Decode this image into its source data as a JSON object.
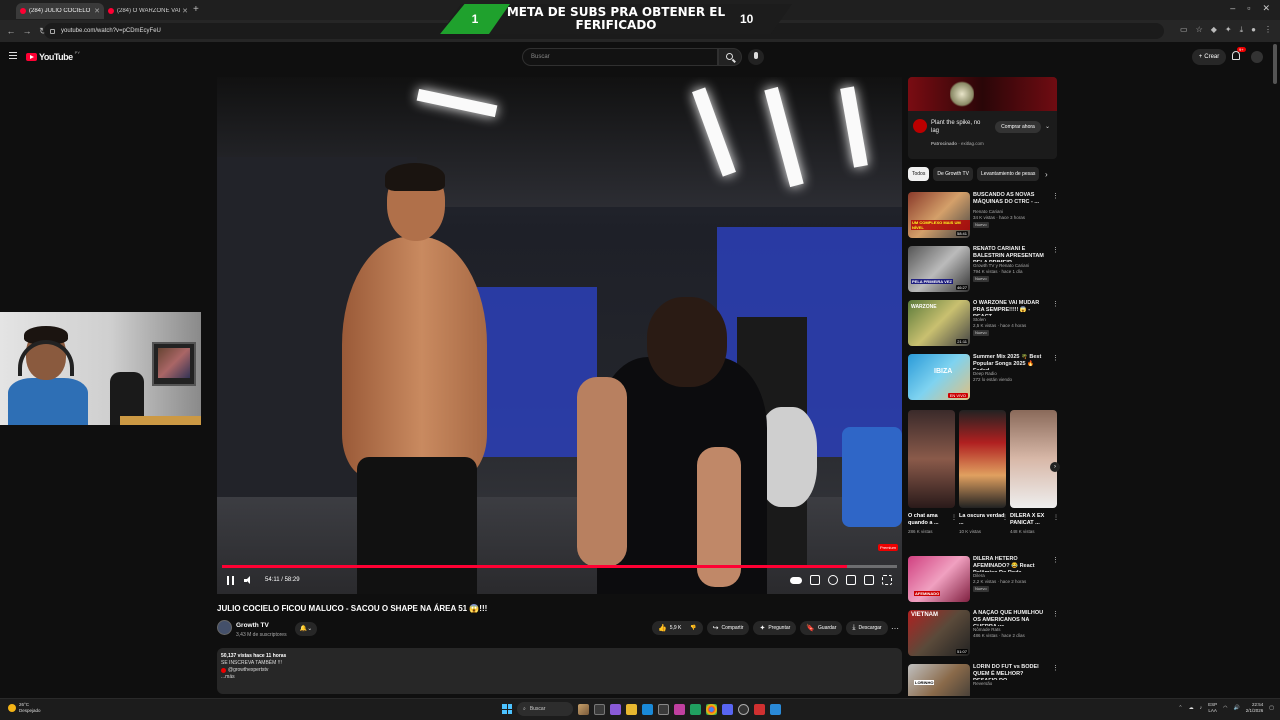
{
  "browser": {
    "tabs": [
      {
        "label": "(284) JULIO COCIELO FICO"
      },
      {
        "label": "(284) O WARZONE VAI MUDAR"
      }
    ],
    "url": "youtube.com/watch?v=pCDmEcyFeU"
  },
  "overlay": {
    "left_number": "1",
    "text": "META DE SUBS PRA OBTENER EL FERIFICADO",
    "right_number": "10"
  },
  "header": {
    "logo_text": "YouTube",
    "logo_cc": "PY",
    "search_placeholder": "Buscar",
    "create_label": "Crear",
    "notification_count": "9+"
  },
  "player": {
    "time": "54:11 / 58:29",
    "progress": 0.926,
    "quality_badge": "Premium"
  },
  "video": {
    "title": "JULIO COCIELO FICOU MALUCO - SACOU O SHAPE NA ÁREA 51 😱!!!",
    "channel_name": "Growth TV",
    "channel_subs": "3,43 M de suscriptores",
    "likes": "5,9 K",
    "share_label": "Compartir",
    "ask_label": "Preguntar",
    "save_label": "Guardar",
    "download_label": "Descargar",
    "description": {
      "stats": "50,137 vistas  hace 11 horas",
      "line1": "SE INSCREVA TAMBÉM !!!",
      "handle": "@growthexpertstv",
      "more": "...más"
    }
  },
  "sidebar": {
    "ad": {
      "title": "Plant the spike, no lag",
      "sponsored": "Patrocinado",
      "domain": "exitlag.com",
      "button": "Comprar ahora"
    },
    "chips": [
      "Todos",
      "De Growth TV",
      "Levantamiento de pesas"
    ],
    "recommendations": [
      {
        "title": "BUSCANDO AS NOVAS MÁQUINAS DO CTRC - ...",
        "channel": "Renato Cariani",
        "views": "34 K vistas · hace 3 horas",
        "badge": "Nuevo",
        "duration": "58:41",
        "thumb_text": "UM COMPLEXO MAIS UM NÍVEL"
      },
      {
        "title": "RENATO CARIANI E BALESTRIN APRESENTAM PELA PRIMEIR...",
        "channel": "Growth TV y Renato Cariani",
        "views": "794 K vistas · hace 1 día",
        "badge": "Nuevo",
        "duration": "46:27",
        "thumb_text": "PELA PRIMEIRA VEZ"
      },
      {
        "title": "O WARZONE VAI MUDAR PRA SEMPRE!!!!! 😱 - REACT ...",
        "channel": "Stolen",
        "views": "2,5 K vistas · hace 4 horas",
        "badge": "Nuevo",
        "duration": "21:11",
        "thumb_text": "WARZONE"
      },
      {
        "title": "Summer Mix 2025 🌴 Best Popular Songs 2025 🔥 Faded...",
        "channel": "Deep Radio",
        "views": "272 lo están viendo",
        "badge": "",
        "duration": "EN VIVO",
        "thumb_text": "IBIZA"
      },
      {
        "title": "DILERA HÉTERO AFEMINADO? 😂 React Polêmico Do Roda ...",
        "channel": "Dilera",
        "views": "2,2 K vistas · hace 2 horas",
        "badge": "Nuevo",
        "duration": "",
        "thumb_text": "AFEMINADO"
      },
      {
        "title": "A NAÇÃO QUE HUMILHOU OS AMERICANOS NA GUERRA vs",
        "channel": "Nômade Rats",
        "views": "486 K vistas · hace 2 días",
        "badge": "",
        "duration": "51:07",
        "thumb_text": "VIETNAM"
      },
      {
        "title": "LORIN DO FUT vs BODEI QUEM É MELHOR? DESAFIO DO ...",
        "channel": "Reversão",
        "views": "",
        "badge": "",
        "duration": "",
        "thumb_text": "LORINHO"
      }
    ],
    "shorts": [
      {
        "title": "O chat ama quando a ...",
        "views": "286 K vistas"
      },
      {
        "title": "La oscura verdad ...",
        "views": "10 K vistas"
      },
      {
        "title": "DILERA X EX PANICAT ...",
        "views": "448 K vistas"
      }
    ]
  },
  "taskbar": {
    "weather_temp": "26°C",
    "weather_desc": "Despejado",
    "search": "Buscar",
    "lang": "ESP",
    "lang2": "LAA",
    "time": "22:54",
    "date": "2/1/2026"
  }
}
